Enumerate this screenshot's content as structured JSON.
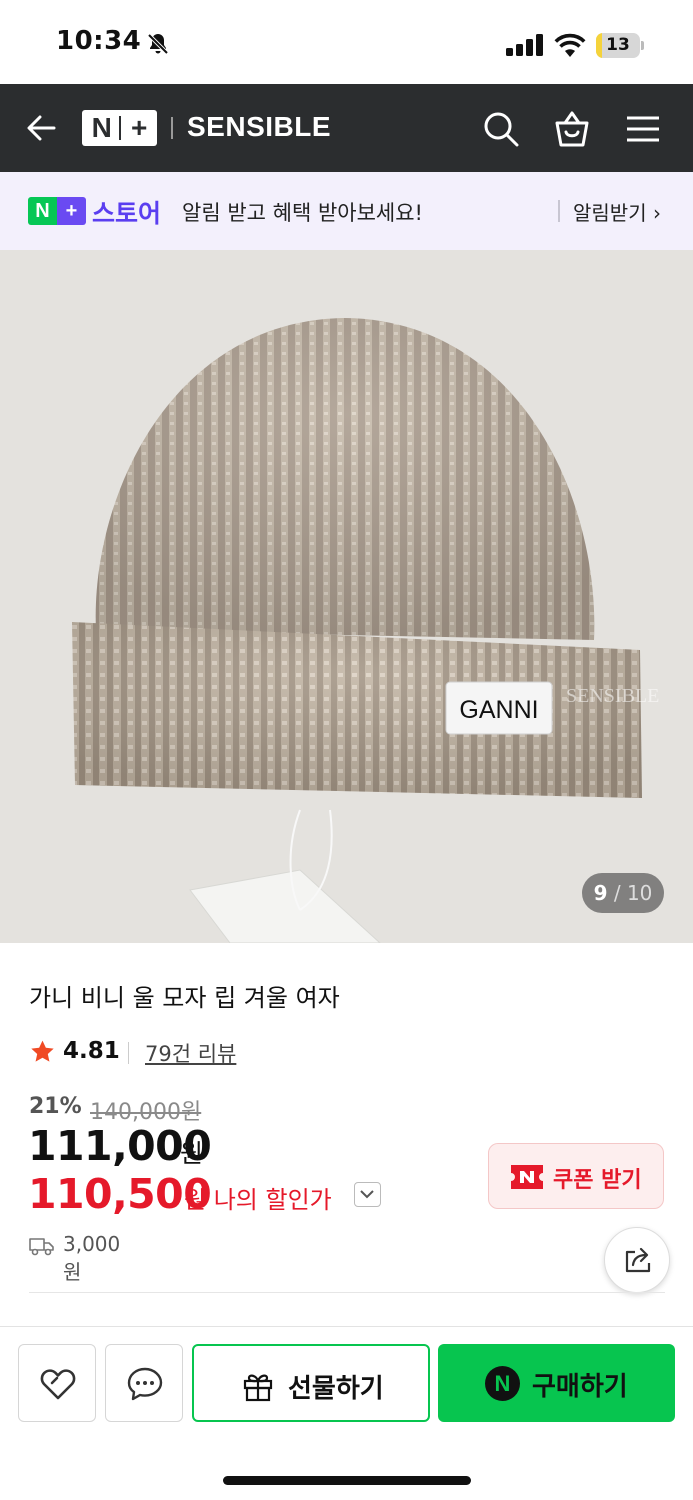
{
  "status_bar": {
    "time": "10:34",
    "battery": "13",
    "battery_level": 0.13
  },
  "header": {
    "logo_left": "N",
    "logo_right": "+",
    "store_name": "SENSIBLE"
  },
  "banner": {
    "badge_left": "N",
    "badge_right": "+",
    "store_label": "스토어",
    "message": "알림 받고 혜택 받아보세요!",
    "action": "알림받기 ›"
  },
  "image": {
    "label_text": "GANNI",
    "watermark": "SENSIBLE",
    "current": "9",
    "total": "10"
  },
  "product": {
    "title": "가니 비니 울 모자 립 겨울 여자",
    "rating": "4.81",
    "review_link": "79건 리뷰",
    "discount_rate": "21%",
    "original_price": "140,000원",
    "sale_price": "111,000",
    "sale_unit": "원",
    "my_price": "110,500",
    "my_price_label": "원 나의 할인가",
    "coupon_label": "쿠폰 받기",
    "shipping_fee": "3,000원"
  },
  "bottom_bar": {
    "gift_label": "선물하기",
    "buy_icon": "N",
    "buy_label": "구매하기"
  },
  "colors": {
    "header_bg": "#2b2d2f",
    "brand_green": "#07c54f",
    "price_red": "#e5192a",
    "banner_bg": "#f3f0fc",
    "store_purple": "#5a3ef0"
  }
}
